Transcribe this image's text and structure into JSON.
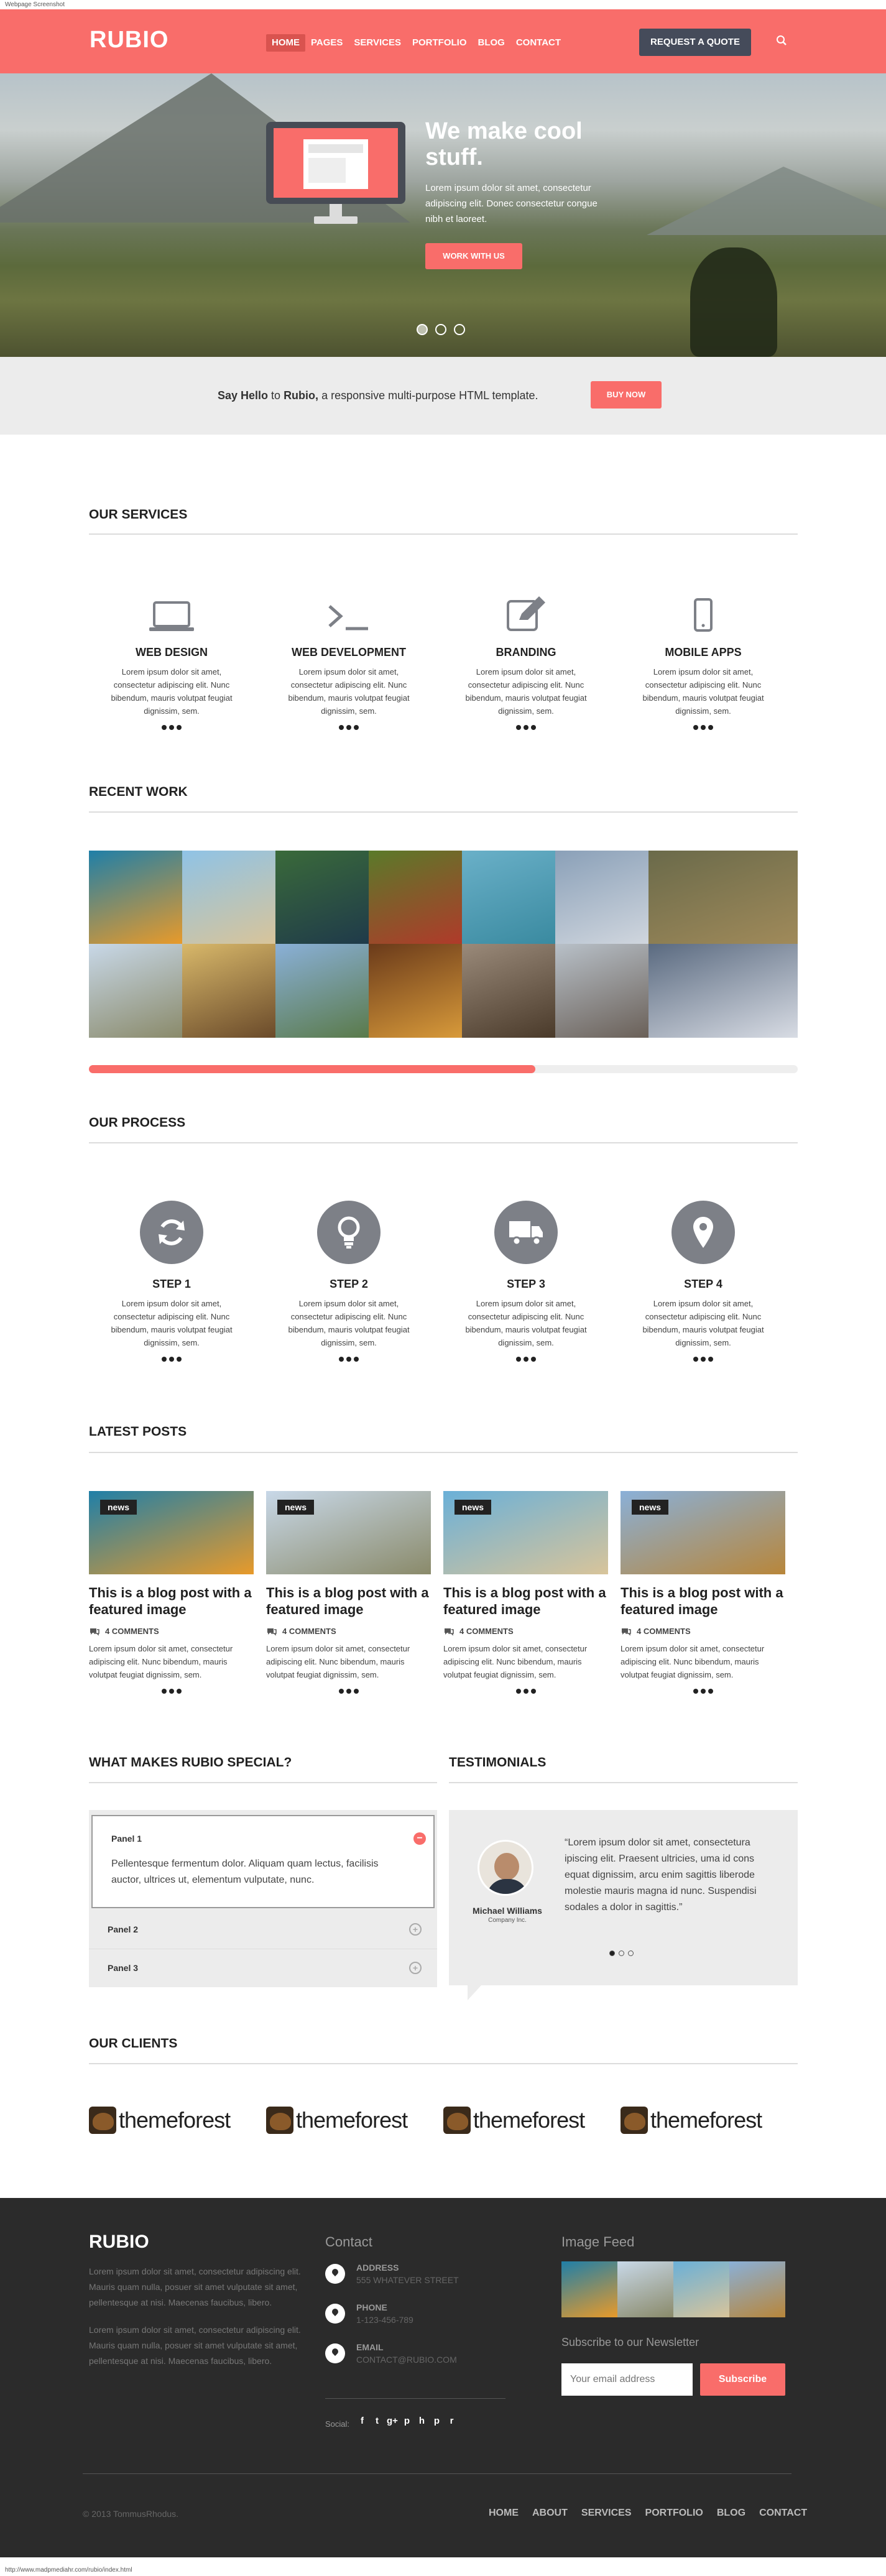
{
  "browser": {
    "tab_title": "Webpage Screenshot",
    "status_url": "http://www.madpmediahr.com/rubio/index.html"
  },
  "header": {
    "logo": "RUBIO",
    "nav": [
      "HOME",
      "PAGES",
      "SERVICES",
      "PORTFOLIO",
      "BLOG",
      "CONTACT"
    ],
    "active_nav": "HOME",
    "cta": "REQUEST A QUOTE",
    "search_icon": "search-icon"
  },
  "hero": {
    "title": "We make cool stuff.",
    "text": "Lorem ipsum dolor sit amet, consectetur adipiscing elit. Donec consectetur congue nibh et laoreet.",
    "button": "WORK WITH US",
    "slides": 3,
    "active_slide": 1
  },
  "hello": {
    "pre": "Say Hello",
    "mid": " to ",
    "brand": "Rubio,",
    "post": " a responsive multi-purpose HTML template.",
    "button": "BUY NOW"
  },
  "services": {
    "title": "OUR SERVICES",
    "items": [
      {
        "icon": "laptop-icon",
        "title": "WEB DESIGN",
        "text": "Lorem ipsum dolor sit amet, consectetur adipiscing elit. Nunc bibendum, mauris volutpat feugiat dignissim, sem."
      },
      {
        "icon": "terminal-icon",
        "title": "WEB DEVELOPMENT",
        "text": "Lorem ipsum dolor sit amet, consectetur adipiscing elit. Nunc bibendum, mauris volutpat feugiat dignissim, sem."
      },
      {
        "icon": "edit-icon",
        "title": "BRANDING",
        "text": "Lorem ipsum dolor sit amet, consectetur adipiscing elit. Nunc bibendum, mauris volutpat feugiat dignissim, sem."
      },
      {
        "icon": "mobile-icon",
        "title": "MOBILE APPS",
        "text": "Lorem ipsum dolor sit amet, consectetur adipiscing elit. Nunc bibendum, mauris volutpat feugiat dignissim, sem."
      }
    ]
  },
  "recent_work": {
    "title": "RECENT WORK",
    "tiles": [
      {
        "name": "fish",
        "colors": [
          "#1f7fa8",
          "#e89a2a"
        ]
      },
      {
        "name": "beach-rider",
        "colors": [
          "#8fc3e6",
          "#d8c49a"
        ]
      },
      {
        "name": "tree-coast",
        "colors": [
          "#3a6a3a",
          "#1f3a4a"
        ]
      },
      {
        "name": "woman-trees",
        "colors": [
          "#5a7a2a",
          "#b03a2a"
        ]
      },
      {
        "name": "pool",
        "colors": [
          "#6ab0c8",
          "#3a8aa0"
        ]
      },
      {
        "name": "city",
        "colors": [
          "#8aa0b8",
          "#d0d6de"
        ]
      },
      {
        "name": "palm-edge",
        "colors": [
          "#6a6a4a",
          "#a08a5a"
        ]
      },
      {
        "name": "palms",
        "colors": [
          "#c8d8e8",
          "#8a8a6a"
        ]
      },
      {
        "name": "dancers",
        "colors": [
          "#d8b86a",
          "#6a4a2a"
        ]
      },
      {
        "name": "resort",
        "colors": [
          "#8ab0d8",
          "#5a7a4a"
        ]
      },
      {
        "name": "crowd",
        "colors": [
          "#6a3a1a",
          "#d89a3a"
        ]
      },
      {
        "name": "tree-road",
        "colors": [
          "#9a8a7a",
          "#4a3a2a"
        ]
      },
      {
        "name": "pier",
        "colors": [
          "#b8c0c8",
          "#6a6058"
        ]
      },
      {
        "name": "angel",
        "colors": [
          "#5a6a80",
          "#d8dce4"
        ]
      }
    ],
    "progress": 0.63
  },
  "process": {
    "title": "OUR PROCESS",
    "items": [
      {
        "icon": "refresh-icon",
        "title": "STEP 1",
        "text": "Lorem ipsum dolor sit amet, consectetur adipiscing elit. Nunc bibendum, mauris volutpat feugiat dignissim, sem."
      },
      {
        "icon": "lightbulb-icon",
        "title": "STEP 2",
        "text": "Lorem ipsum dolor sit amet, consectetur adipiscing elit. Nunc bibendum, mauris volutpat feugiat dignissim, sem."
      },
      {
        "icon": "truck-icon",
        "title": "STEP 3",
        "text": "Lorem ipsum dolor sit amet, consectetur adipiscing elit. Nunc bibendum, mauris volutpat feugiat dignissim, sem."
      },
      {
        "icon": "map-marker-icon",
        "title": "STEP 4",
        "text": "Lorem ipsum dolor sit amet, consectetur adipiscing elit. Nunc bibendum, mauris volutpat feugiat dignissim, sem."
      }
    ]
  },
  "posts": {
    "title": "LATEST POSTS",
    "items": [
      {
        "badge": "news",
        "title": "This is a blog post with a featured image",
        "comments": "4 COMMENTS",
        "text": "Lorem ipsum dolor sit amet, consectetur adipiscing elit. Nunc bibendum, mauris volutpat feugiat dignissim, sem.",
        "colors": [
          "#1f7fa8",
          "#e89a2a"
        ]
      },
      {
        "badge": "news",
        "title": "This is a blog post with a featured image",
        "comments": "4 COMMENTS",
        "text": "Lorem ipsum dolor sit amet, consectetur adipiscing elit. Nunc bibendum, mauris volutpat feugiat dignissim, sem.",
        "colors": [
          "#c8d8e8",
          "#8a8a6a"
        ]
      },
      {
        "badge": "news",
        "title": "This is a blog post with a featured image",
        "comments": "4 COMMENTS",
        "text": "Lorem ipsum dolor sit amet, consectetur adipiscing elit. Nunc bibendum, mauris volutpat feugiat dignissim, sem.",
        "colors": [
          "#6ab0d8",
          "#d8c49a"
        ]
      },
      {
        "badge": "news",
        "title": "This is a blog post with a featured image",
        "comments": "4 COMMENTS",
        "text": "Lorem ipsum dolor sit amet, consectetur adipiscing elit. Nunc bibendum, mauris volutpat feugiat dignissim, sem.",
        "colors": [
          "#8ab0d8",
          "#b8863a"
        ]
      }
    ]
  },
  "special": {
    "title": "WHAT MAKES RUBIO SPECIAL?",
    "panels": [
      {
        "title": "Panel 1",
        "text": "Pellentesque fermentum dolor. Aliquam quam lectus, facilisis auctor, ultrices ut, elementum vulputate, nunc.",
        "open": true
      },
      {
        "title": "Panel 2",
        "open": false
      },
      {
        "title": "Panel 3",
        "open": false
      }
    ]
  },
  "testimonials": {
    "title": "TESTIMONIALS",
    "quote": "“Lorem ipsum dolor sit amet, consectetura ipiscing elit. Praesent ultricies, uma id cons equat dignissim, arcu enim sagittis liberode molestie mauris magna id nunc. Suspendisi sodales a dolor in sagittis.”",
    "name": "Michael Williams",
    "company": "Company Inc.",
    "slides": 3,
    "active_slide": 1
  },
  "clients": {
    "title": "OUR CLIENTS",
    "logos": [
      "themeforest",
      "themeforest",
      "themeforest",
      "themeforest"
    ]
  },
  "footer": {
    "logo": "RUBIO",
    "para1": "Lorem ipsum dolor sit amet, consectetur adipiscing elit. Mauris quam nulla, posuer sit amet vulputate sit amet, pellentesque at nisi. Maecenas faucibus, libero.",
    "para2": "Lorem ipsum dolor sit amet, consectetur adipiscing elit. Mauris quam nulla, posuer sit amet vulputate sit amet, pellentesque at nisi. Maecenas faucibus, libero.",
    "contact_title": "Contact",
    "contact": [
      {
        "label": "ADDRESS",
        "value": "555 WHATEVER STREET"
      },
      {
        "label": "PHONE",
        "value": "1-123-456-789"
      },
      {
        "label": "EMAIL",
        "value": "CONTACT@RUBIO.COM"
      }
    ],
    "social_label": "Social:",
    "social": [
      "f",
      "t",
      "g+",
      "p",
      "h",
      "p",
      "r"
    ],
    "feed_title": "Image Feed",
    "feed": [
      {
        "colors": [
          "#1f7fa8",
          "#e89a2a"
        ]
      },
      {
        "colors": [
          "#c8d8e8",
          "#8a8a6a"
        ]
      },
      {
        "colors": [
          "#6ab0d8",
          "#d8c49a"
        ]
      },
      {
        "colors": [
          "#8ab0d8",
          "#b8863a"
        ]
      }
    ],
    "newsletter_title": "Subscribe to our Newsletter",
    "newsletter_placeholder": "Your email address",
    "newsletter_button": "Subscribe",
    "copyright": "© 2013 TommusRhodus.",
    "nav": [
      "HOME",
      "ABOUT",
      "SERVICES",
      "PORTFOLIO",
      "BLOG",
      "CONTACT"
    ]
  },
  "colors": {
    "accent": "#f96d6a",
    "dark": "#454b5a",
    "footer": "#2b2b2b",
    "icon_circle": "#7d8087"
  }
}
